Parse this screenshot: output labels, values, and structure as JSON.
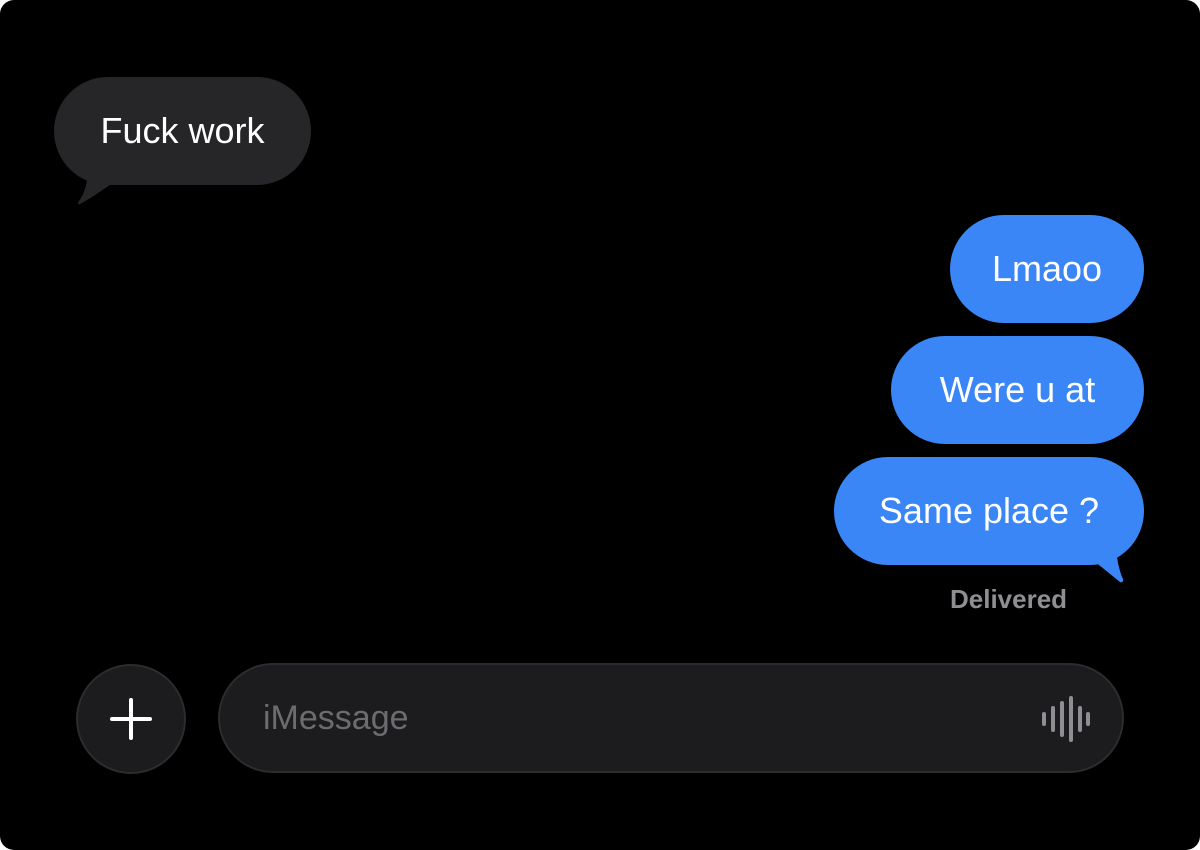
{
  "conversation": {
    "messages": [
      {
        "direction": "incoming",
        "text": "Fuck work"
      },
      {
        "direction": "outgoing",
        "text": "Lmaoo"
      },
      {
        "direction": "outgoing",
        "text": "Were u at"
      },
      {
        "direction": "outgoing",
        "text": "Same place ?"
      }
    ],
    "status": "Delivered"
  },
  "composer": {
    "placeholder": "iMessage",
    "plus_icon": "plus-icon",
    "voice_icon": "waveform-icon"
  },
  "colors": {
    "background": "#000000",
    "incoming_bubble": "#262628",
    "outgoing_bubble": "#3b86f6",
    "status_text": "#8e8e93",
    "input_background": "#1c1c1e"
  }
}
